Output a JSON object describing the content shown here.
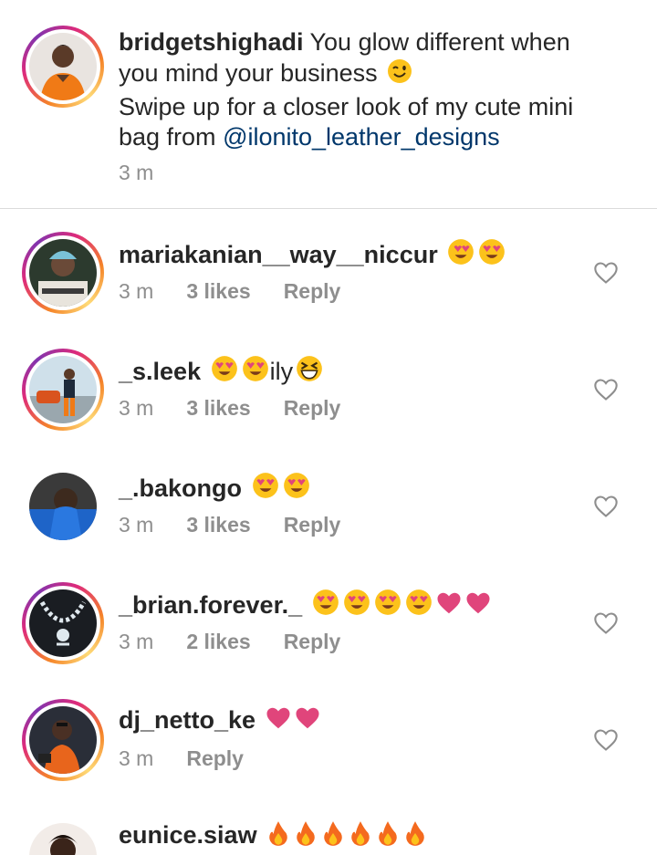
{
  "post": {
    "username": "bridgetshighadi",
    "caption_line1": " You glow different when",
    "caption_line2": "you mind your business ",
    "caption_line2_emoji": "winking-face",
    "caption_line3": "Swipe up for a closer look of my cute mini",
    "caption_line4_prefix": "bag from ",
    "mention": "@ilonito_leather_designs",
    "time": "3 m"
  },
  "reply_label": "Reply",
  "comments": [
    {
      "username": "mariakanian__way__niccur",
      "text": "",
      "emojis": [
        "heart-eyes",
        "heart-eyes"
      ],
      "time": "3 m",
      "likes": "3 likes",
      "avatar_ring": true
    },
    {
      "username": "_s.leek",
      "text": "ily",
      "emojis_before": [
        "heart-eyes",
        "heart-eyes"
      ],
      "emojis_after": [
        "grinning-squint"
      ],
      "time": "3 m",
      "likes": "3 likes",
      "avatar_ring": true
    },
    {
      "username": "_.bakongo",
      "text": "",
      "emojis": [
        "heart-eyes",
        "heart-eyes"
      ],
      "time": "3 m",
      "likes": "3 likes",
      "avatar_ring": false
    },
    {
      "username": "_brian.forever._",
      "text": "",
      "emojis": [
        "heart-eyes",
        "heart-eyes",
        "heart-eyes",
        "heart-eyes",
        "pink-heart",
        "pink-heart"
      ],
      "time": "3 m",
      "likes": "2 likes",
      "avatar_ring": true
    },
    {
      "username": "dj_netto_ke",
      "text": "",
      "emojis": [
        "pink-heart",
        "pink-heart"
      ],
      "time": "3 m",
      "likes": "",
      "avatar_ring": true
    },
    {
      "username": "eunice.siaw",
      "text": "",
      "emojis": [
        "fire",
        "fire",
        "fire",
        "fire",
        "fire",
        "fire"
      ],
      "time": "",
      "likes": "",
      "avatar_ring": false
    }
  ],
  "colors": {
    "text": "#262626",
    "muted": "#8e8e8e",
    "mention": "#00376b",
    "divider": "#dbdbdb",
    "heart_emoji": "#e0457b"
  }
}
